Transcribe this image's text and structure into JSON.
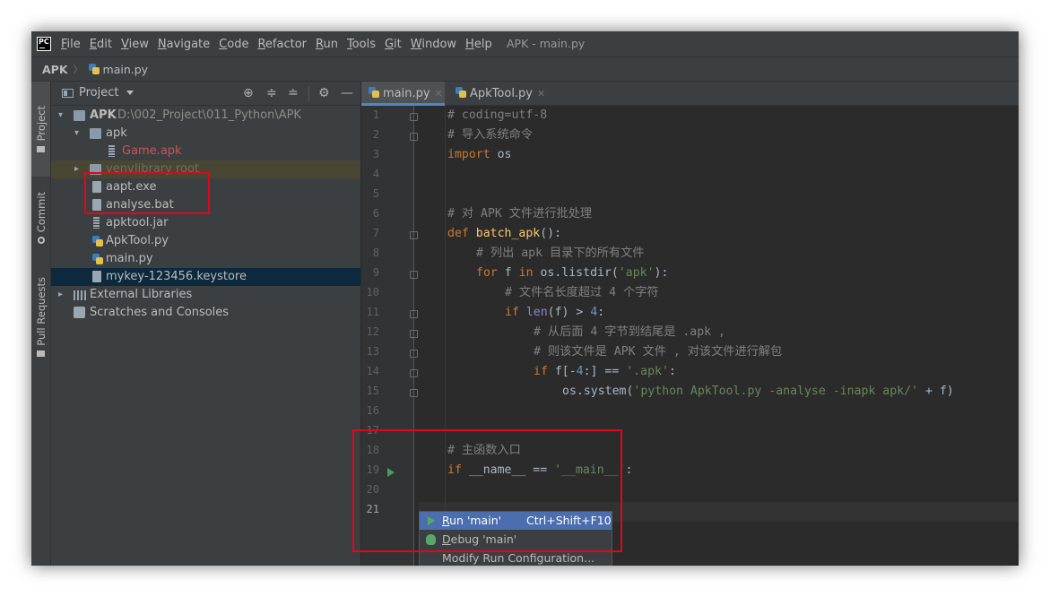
{
  "menubar": {
    "logo": "PC",
    "items": [
      {
        "mn": "F",
        "rest": "ile"
      },
      {
        "mn": "E",
        "rest": "dit"
      },
      {
        "mn": "V",
        "rest": "iew"
      },
      {
        "mn": "N",
        "rest": "avigate"
      },
      {
        "mn": "C",
        "rest": "ode"
      },
      {
        "mn": "R",
        "rest": "efactor"
      },
      {
        "mn": "R",
        "rest": "un"
      },
      {
        "mn": "T",
        "rest": "ools"
      },
      {
        "mn": "G",
        "rest": "it"
      },
      {
        "mn": "W",
        "rest": "indow"
      },
      {
        "mn": "H",
        "rest": "elp"
      }
    ],
    "window_title": "APK - main.py"
  },
  "breadcrumb": {
    "root": "APK",
    "file": "main.py"
  },
  "tool_stripe": {
    "project": "Project",
    "commit": "Commit",
    "pull_requests": "Pull Requests"
  },
  "project_panel": {
    "title": "Project",
    "tree": {
      "root_name": "APK",
      "root_path": "D:\\002_Project\\011_Python\\APK",
      "apk_folder": "apk",
      "game_apk": "Game.apk",
      "venv": "venv",
      "venv_note": "library root",
      "files": [
        "aapt.exe",
        "analyse.bat",
        "apktool.jar",
        "ApkTool.py",
        "main.py",
        "mykey-123456.keystore"
      ],
      "external_libraries": "External Libraries",
      "scratches": "Scratches and Consoles"
    }
  },
  "editor": {
    "tabs": [
      "main.py",
      "ApkTool.py"
    ],
    "line_numbers": [
      "1",
      "2",
      "3",
      "4",
      "5",
      "6",
      "7",
      "8",
      "9",
      "10",
      "11",
      "12",
      "13",
      "14",
      "15",
      "16",
      "17",
      "18",
      "19",
      "20",
      "21"
    ],
    "code": {
      "l1": "# coding=utf-8",
      "l2": "# 导入系统命令",
      "l3_kw": "import",
      "l3_rest": " os",
      "l6": "# 对 APK 文件进行批处理",
      "l7_kw": "def",
      "l7_fn": " batch_apk",
      "l7_rest": "():",
      "l8": "# 列出 apk 目录下的所有文件",
      "l9_kw": "for",
      "l9_a": " f ",
      "l9_kw2": "in",
      "l9_b": " os.listdir(",
      "l9_st": "'apk'",
      "l9_c": "):",
      "l10": "# 文件名长度超过 4 个字符",
      "l11_kw": "if",
      "l11_sp": " ",
      "l11_bi": "len",
      "l11_a": "(f) > ",
      "l11_nm": "4",
      "l11_b": ":",
      "l12": "# 从后面 4 字节到结尾是 .apk ,",
      "l13": "# 则该文件是 APK 文件 , 对该文件进行解包",
      "l14_kw": "if",
      "l14_a": " f[-",
      "l14_nm": "4",
      "l14_b": ":] == ",
      "l14_st": "'.apk'",
      "l14_c": ":",
      "l15_a": "os.system(",
      "l15_st": "'python ApkTool.py -analyse -inapk apk/'",
      "l15_b": " + f)",
      "l18": "# 主函数入口",
      "l19_kw": "if",
      "l19_a": " __name__ == ",
      "l19_st": "'__main__'",
      "l19_b": ":"
    }
  },
  "run_popup": {
    "items": [
      {
        "label_mn": "R",
        "label_rest": "un 'main'",
        "shortcut": "Ctrl+Shift+F10"
      },
      {
        "label_mn": "D",
        "label_rest": "ebug 'main'",
        "shortcut": ""
      },
      {
        "label_mn": "",
        "label_rest": "Modify Run Configuration...",
        "shortcut": ""
      }
    ]
  }
}
